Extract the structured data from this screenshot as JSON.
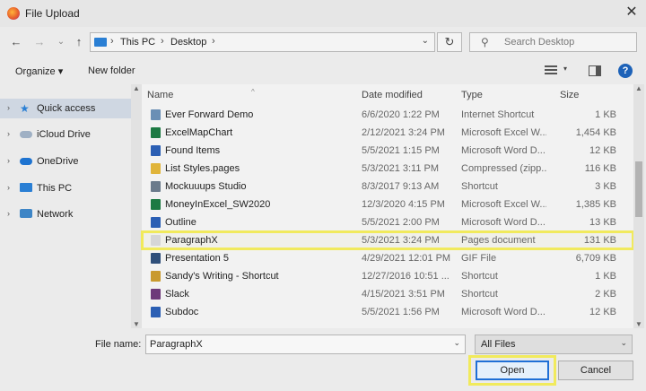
{
  "window": {
    "title": "File Upload",
    "close_glyph": "✕"
  },
  "nav": {
    "back": "←",
    "forward": "→",
    "recent": "⌄",
    "up": "↑",
    "crumbs": [
      "This PC",
      "Desktop"
    ],
    "refresh": "↻",
    "search_placeholder": "Search Desktop"
  },
  "toolbar": {
    "organize": "Organize ▾",
    "new_folder": "New folder",
    "help": "?"
  },
  "sidebar": {
    "items": [
      {
        "label": "Quick access",
        "icon": "star-icon"
      },
      {
        "label": "iCloud Drive",
        "icon": "cloud-icon"
      },
      {
        "label": "OneDrive",
        "icon": "onedrive-icon"
      },
      {
        "label": "This PC",
        "icon": "computer-icon"
      },
      {
        "label": "Network",
        "icon": "network-icon"
      }
    ]
  },
  "columns": {
    "name": "Name",
    "date": "Date modified",
    "type": "Type",
    "size": "Size"
  },
  "files": [
    {
      "name": "Ever Forward Demo",
      "date": "6/6/2020 1:22 PM",
      "type": "Internet Shortcut",
      "size": "1 KB",
      "icon": "internet-shortcut-icon",
      "color": "#6a8fb5"
    },
    {
      "name": "ExcelMapChart",
      "date": "2/12/2021 3:24 PM",
      "type": "Microsoft Excel W...",
      "size": "1,454 KB",
      "icon": "excel-icon",
      "color": "#1d7a43"
    },
    {
      "name": "Found Items",
      "date": "5/5/2021 1:15 PM",
      "type": "Microsoft Word D...",
      "size": "12 KB",
      "icon": "word-icon",
      "color": "#2b5fb4"
    },
    {
      "name": "List Styles.pages",
      "date": "5/3/2021 3:11 PM",
      "type": "Compressed (zipp...",
      "size": "116 KB",
      "icon": "zip-icon",
      "color": "#e0b43a"
    },
    {
      "name": "Mockuuups Studio",
      "date": "8/3/2017 9:13 AM",
      "type": "Shortcut",
      "size": "3 KB",
      "icon": "shortcut-icon",
      "color": "#6b7b8c"
    },
    {
      "name": "MoneyInExcel_SW2020",
      "date": "12/3/2020 4:15 PM",
      "type": "Microsoft Excel W...",
      "size": "1,385 KB",
      "icon": "excel-icon",
      "color": "#1d7a43"
    },
    {
      "name": "Outline",
      "date": "5/5/2021 2:00 PM",
      "type": "Microsoft Word D...",
      "size": "13 KB",
      "icon": "word-icon",
      "color": "#2b5fb4"
    },
    {
      "name": "ParagraphX",
      "date": "5/3/2021 3:24 PM",
      "type": "Pages document",
      "size": "131 KB",
      "icon": "document-icon",
      "color": "#d6d6d6"
    },
    {
      "name": "Presentation 5",
      "date": "4/29/2021 12:01 PM",
      "type": "GIF File",
      "size": "6,709 KB",
      "icon": "image-icon",
      "color": "#2f4f7a"
    },
    {
      "name": "Sandy's Writing - Shortcut",
      "date": "12/27/2016 10:51 ...",
      "type": "Shortcut",
      "size": "1 KB",
      "icon": "shortcut-icon",
      "color": "#c99a2e"
    },
    {
      "name": "Slack",
      "date": "4/15/2021 3:51 PM",
      "type": "Shortcut",
      "size": "2 KB",
      "icon": "slack-icon",
      "color": "#6e3a7a"
    },
    {
      "name": "Subdoc",
      "date": "5/5/2021 1:56 PM",
      "type": "Microsoft Word D...",
      "size": "12 KB",
      "icon": "word-icon",
      "color": "#2b5fb4"
    }
  ],
  "footer": {
    "file_name_label": "File name:",
    "file_name_value": "ParagraphX",
    "filter": "All Files",
    "open": "Open",
    "cancel": "Cancel"
  }
}
